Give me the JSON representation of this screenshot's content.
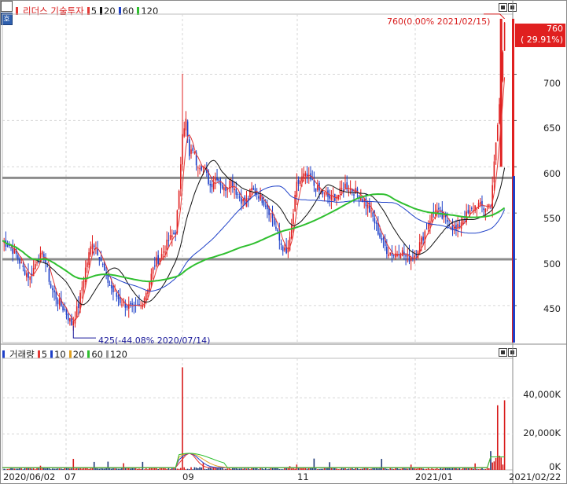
{
  "price_panel": {
    "legend": {
      "stock_name": "리더스 기술투자",
      "ma_items": [
        {
          "label": "5",
          "color": "#e53935"
        },
        {
          "label": "20",
          "color": "#111111"
        },
        {
          "label": "60",
          "color": "#1e40c8"
        },
        {
          "label": "120",
          "color": "#2fbf2f"
        }
      ]
    },
    "corner_label": "호",
    "y_ticks": [
      "700",
      "650",
      "600",
      "550",
      "500",
      "450"
    ],
    "current_price": "760",
    "current_change": "( 29.91%)",
    "high_annotation": "760(0.00% 2021/02/15)",
    "low_annotation": "425(-44.08% 2020/07/14)"
  },
  "volume_panel": {
    "legend": {
      "title": "거래량",
      "ma_items": [
        {
          "label": "5",
          "color": "#e53935"
        },
        {
          "label": "10",
          "color": "#1e40c8"
        },
        {
          "label": "20",
          "color": "#e0a020"
        },
        {
          "label": "60",
          "color": "#2fbf2f"
        },
        {
          "label": "120",
          "color": "#9a9a9a"
        }
      ]
    },
    "y_ticks": [
      "40,000K",
      "20,000K",
      "0K"
    ]
  },
  "x_axis": [
    "2020/06/02",
    "07",
    "09",
    "11",
    "2021/01",
    "2021/02/22"
  ],
  "colors": {
    "up": "#e02020",
    "down": "#1e40c8",
    "hline": "#8c8c8c"
  },
  "chart_data": {
    "type": "candlestick",
    "x_range": [
      "2020/06/02",
      "2021/02/22"
    ],
    "y_range": [
      410,
      765
    ],
    "horizontal_lines": [
      588,
      500
    ],
    "high": {
      "value": 760,
      "date": "2021/02/15"
    },
    "low": {
      "value": 425,
      "date": "2020/07/14"
    },
    "close_series_approx": [
      [
        0,
        520
      ],
      [
        4,
        515
      ],
      [
        8,
        505
      ],
      [
        12,
        490
      ],
      [
        16,
        480
      ],
      [
        20,
        500
      ],
      [
        24,
        505
      ],
      [
        28,
        470
      ],
      [
        32,
        455
      ],
      [
        36,
        445
      ],
      [
        40,
        430
      ],
      [
        44,
        450
      ],
      [
        48,
        490
      ],
      [
        52,
        520
      ],
      [
        56,
        505
      ],
      [
        60,
        480
      ],
      [
        64,
        465
      ],
      [
        68,
        455
      ],
      [
        72,
        450
      ],
      [
        76,
        445
      ],
      [
        80,
        450
      ],
      [
        84,
        470
      ],
      [
        88,
        495
      ],
      [
        92,
        505
      ],
      [
        96,
        520
      ],
      [
        100,
        530
      ],
      [
        102,
        570
      ],
      [
        104,
        640
      ],
      [
        106,
        650
      ],
      [
        108,
        610
      ],
      [
        110,
        620
      ],
      [
        112,
        605
      ],
      [
        116,
        600
      ],
      [
        120,
        580
      ],
      [
        124,
        590
      ],
      [
        128,
        575
      ],
      [
        132,
        585
      ],
      [
        136,
        570
      ],
      [
        140,
        560
      ],
      [
        144,
        575
      ],
      [
        148,
        570
      ],
      [
        152,
        560
      ],
      [
        156,
        545
      ],
      [
        160,
        520
      ],
      [
        164,
        505
      ],
      [
        166,
        520
      ],
      [
        170,
        580
      ],
      [
        174,
        590
      ],
      [
        178,
        585
      ],
      [
        182,
        575
      ],
      [
        186,
        570
      ],
      [
        190,
        565
      ],
      [
        194,
        570
      ],
      [
        198,
        580
      ],
      [
        202,
        575
      ],
      [
        206,
        570
      ],
      [
        210,
        560
      ],
      [
        214,
        545
      ],
      [
        218,
        525
      ],
      [
        222,
        510
      ],
      [
        226,
        505
      ],
      [
        230,
        510
      ],
      [
        234,
        500
      ],
      [
        238,
        505
      ],
      [
        242,
        520
      ],
      [
        246,
        540
      ],
      [
        250,
        555
      ],
      [
        254,
        545
      ],
      [
        258,
        540
      ],
      [
        262,
        530
      ],
      [
        266,
        545
      ],
      [
        270,
        550
      ],
      [
        274,
        560
      ],
      [
        278,
        555
      ],
      [
        282,
        560
      ],
      [
        286,
        645
      ],
      [
        288,
        690
      ],
      [
        290,
        760
      ]
    ],
    "ma_lines": [
      {
        "name": "5",
        "color": "#e53935"
      },
      {
        "name": "20",
        "color": "#111111"
      },
      {
        "name": "60",
        "color": "#1e40c8"
      },
      {
        "name": "120",
        "color": "#2fbf2f"
      }
    ],
    "volume_ticks_k": [
      0,
      20000,
      40000
    ],
    "volume_peaks_k": [
      {
        "date_index": 104,
        "value": 57000
      },
      {
        "date_index": 286,
        "value": 33000
      },
      {
        "date_index": 290,
        "value": 31000
      }
    ]
  }
}
